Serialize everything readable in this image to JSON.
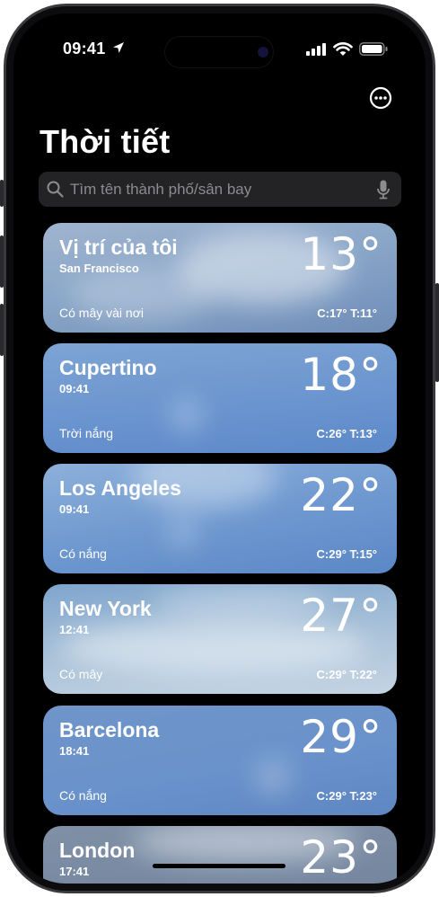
{
  "status_bar": {
    "time": "09:41"
  },
  "header": {
    "title": "Thời tiết"
  },
  "search": {
    "placeholder": "Tìm tên thành phố/sân bay"
  },
  "cities": [
    {
      "name": "Vị trí của tôi",
      "subtitle": "San Francisco",
      "temp": "13°",
      "condition": "Có mây vài nơi",
      "high_low": "C:17° T:11°"
    },
    {
      "name": "Cupertino",
      "subtitle": "09:41",
      "temp": "18°",
      "condition": "Trời nắng",
      "high_low": "C:26° T:13°"
    },
    {
      "name": "Los Angeles",
      "subtitle": "09:41",
      "temp": "22°",
      "condition": "Có nắng",
      "high_low": "C:29° T:15°"
    },
    {
      "name": "New York",
      "subtitle": "12:41",
      "temp": "27°",
      "condition": "Có mây",
      "high_low": "C:29° T:22°"
    },
    {
      "name": "Barcelona",
      "subtitle": "18:41",
      "temp": "29°",
      "condition": "Có nắng",
      "high_low": "C:29° T:23°"
    },
    {
      "name": "London",
      "subtitle": "17:41",
      "temp": "23°"
    }
  ],
  "icons": [
    "location-arrow-icon",
    "signal-icon",
    "wifi-icon",
    "battery-icon",
    "more-icon",
    "search-icon",
    "microphone-icon"
  ]
}
